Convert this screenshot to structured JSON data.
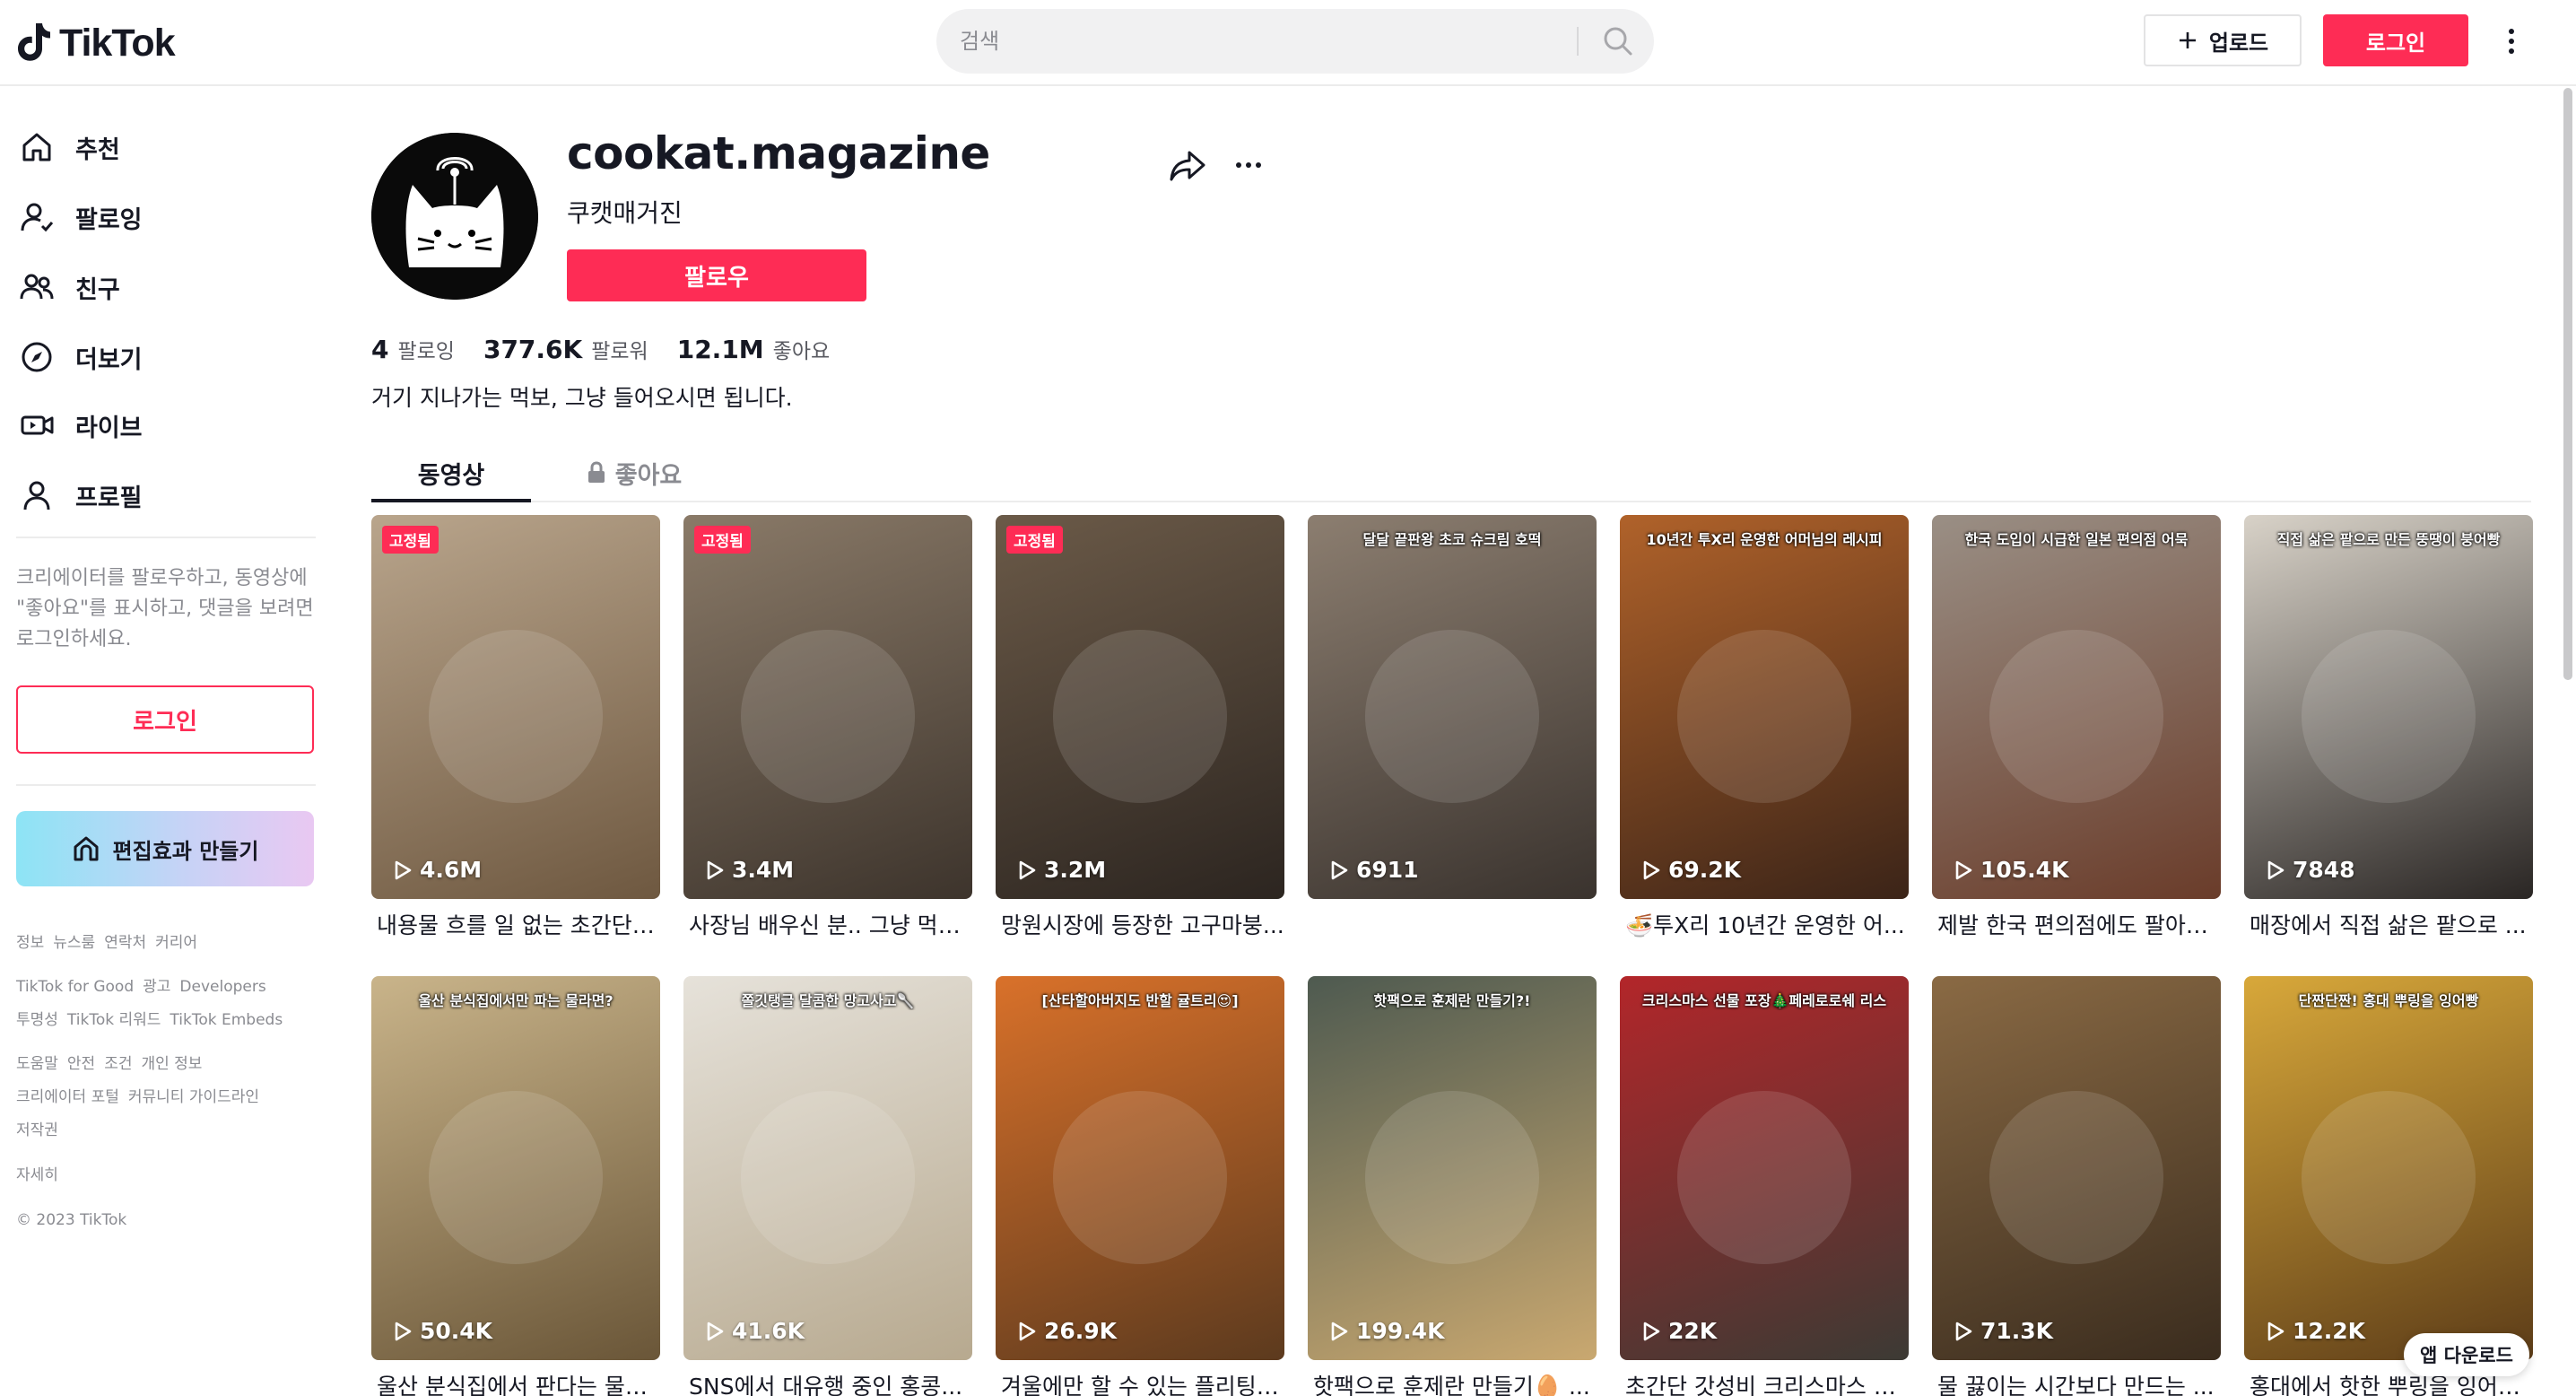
{
  "header": {
    "logo_text": "TikTok",
    "search_placeholder": "검색",
    "upload_label": "업로드",
    "login_label": "로그인"
  },
  "sidebar": {
    "nav": [
      {
        "label": "추천",
        "icon": "home-icon"
      },
      {
        "label": "팔로잉",
        "icon": "following-icon"
      },
      {
        "label": "친구",
        "icon": "friends-icon"
      },
      {
        "label": "더보기",
        "icon": "explore-icon"
      },
      {
        "label": "라이브",
        "icon": "live-icon"
      },
      {
        "label": "프로필",
        "icon": "profile-icon"
      }
    ],
    "login_hint": "크리에이터를 팔로우하고, 동영상에 \"좋아요\"를 표시하고, 댓글을 보려면 로그인하세요.",
    "login_button": "로그인",
    "effect_button": "편집효과 만들기",
    "footer": [
      [
        "정보",
        "뉴스룸",
        "연락처",
        "커리어"
      ],
      [
        "TikTok for Good",
        "광고",
        "Developers"
      ],
      [
        "투명성",
        "TikTok 리워드",
        "TikTok Embeds"
      ],
      [
        "도움말",
        "안전",
        "조건",
        "개인 정보"
      ],
      [
        "크리에이터 포털",
        "커뮤니티 가이드라인"
      ],
      [
        "저작권"
      ],
      [
        "자세히"
      ],
      [
        "© 2023 TikTok"
      ]
    ]
  },
  "profile": {
    "username": "cookat.magazine",
    "nickname": "쿠캣매거진",
    "follow_button": "팔로우",
    "stats": {
      "following_count": "4",
      "following_label": "팔로잉",
      "followers_count": "377.6K",
      "followers_label": "팔로워",
      "likes_count": "12.1M",
      "likes_label": "좋아요"
    },
    "bio": "거기 지나가는 먹보, 그냥 들어오시면 됩니다."
  },
  "tabs": {
    "videos": "동영상",
    "liked": "좋아요"
  },
  "videos": [
    {
      "plays": "4.6M",
      "caption": "내용물 흐를 일 없는 초간단 ...",
      "pinned": "고정됨",
      "overlay": "",
      "colors": [
        "#b9a58c",
        "#6e5840"
      ]
    },
    {
      "plays": "3.4M",
      "caption": "사장님 배우신 분.. 그냥 먹어...",
      "pinned": "고정됨",
      "overlay": "",
      "colors": [
        "#8a7a68",
        "#3d342c"
      ]
    },
    {
      "plays": "3.2M",
      "caption": "망원시장에 등장한 고구마붕...",
      "pinned": "고정됨",
      "overlay": "",
      "colors": [
        "#6b5a48",
        "#2c2520"
      ]
    },
    {
      "plays": "6911",
      "caption": "",
      "pinned": "",
      "overlay": "달달 끝판왕 초코 슈크림 호떡",
      "colors": [
        "#8c7e70",
        "#3a332e"
      ]
    },
    {
      "plays": "69.2K",
      "caption": "🍜투X리 10년간 운영한 어...",
      "pinned": "",
      "overlay": "10년간 투X리 운영한 어머님의 레시피",
      "colors": [
        "#b0622a",
        "#3b2418"
      ]
    },
    {
      "plays": "105.4K",
      "caption": "제발 한국 편의점에도 팔아줬...",
      "pinned": "",
      "overlay": "한국 도입이 시급한 일본 편의점 어묵",
      "colors": [
        "#9a8f85",
        "#6a3c2a"
      ]
    },
    {
      "plays": "7848",
      "caption": "매장에서 직접 삶은 팥으로 ...",
      "pinned": "",
      "overlay": "직접 삶은 팥으로 만든 뚱땡이 붕어빵",
      "colors": [
        "#d8d2c8",
        "#2a2624"
      ]
    },
    {
      "plays": "50.4K",
      "caption": "울산 분식집에서 판다는 물라...",
      "pinned": "",
      "overlay": "울산 분식집에서만 파는 물라면?",
      "colors": [
        "#c9b48a",
        "#6a5638"
      ]
    },
    {
      "plays": "41.6K",
      "caption": "SNS에서 대유행 중인 홍콩...",
      "pinned": "",
      "overlay": "쫄깃탱글 달콤한 망고사고🥄",
      "colors": [
        "#e6e2da",
        "#b7a98f"
      ]
    },
    {
      "plays": "26.9K",
      "caption": "겨울에만 할 수 있는 플리팅 ...",
      "pinned": "",
      "overlay": "[산타할아버지도 반할 귤트리😍]",
      "colors": [
        "#d9712a",
        "#5c3a1e"
      ]
    },
    {
      "plays": "199.4K",
      "caption": "핫팩으로 훈제란 만들기🥚 ...",
      "pinned": "",
      "overlay": "핫팩으로 훈제란 만들기?!",
      "colors": [
        "#4e5a50",
        "#c9a870"
      ]
    },
    {
      "plays": "22K",
      "caption": "초간단 갓성비 크리스마스 선...",
      "pinned": "",
      "overlay": "크리스마스 선물 포장🎄페레로로쉐 리스",
      "colors": [
        "#b3262a",
        "#3c3a34"
      ]
    },
    {
      "plays": "71.3K",
      "caption": "물 끓이는 시간보다 만드는 ...",
      "pinned": "",
      "overlay": "",
      "colors": [
        "#8a6a44",
        "#3a2c1e"
      ]
    },
    {
      "plays": "12.2K",
      "caption": "홍대에서 핫한 뿌링을 잉어빵...",
      "pinned": "",
      "overlay": "단짠단짠! 홍대 뿌링을 잉어빵",
      "colors": [
        "#d8a83a",
        "#5c3c18"
      ]
    }
  ],
  "app_download": "앱 다운로드",
  "colors": {
    "accent": "#fe2c55",
    "text": "#161823",
    "muted": "#8a8b91"
  }
}
